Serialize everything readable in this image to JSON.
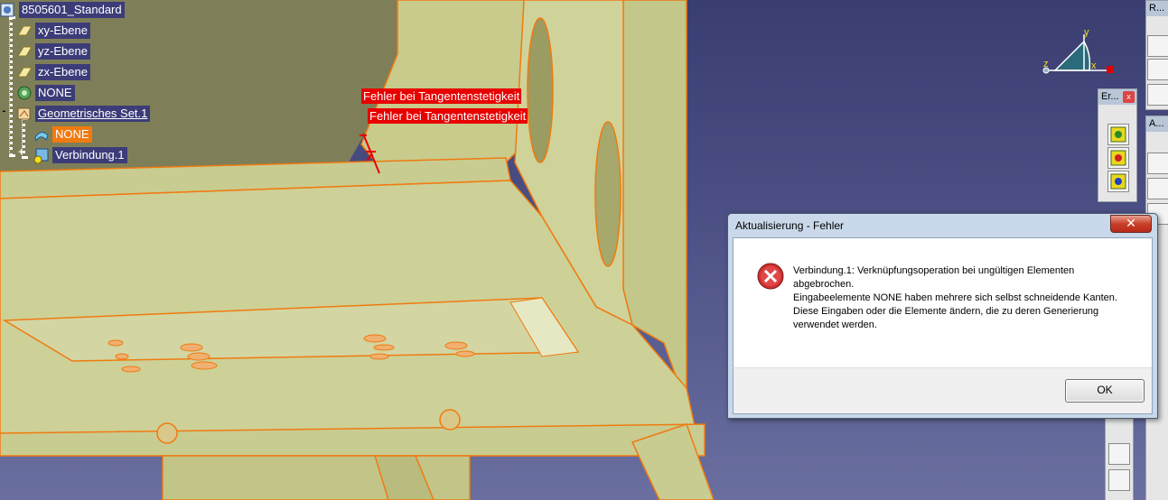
{
  "tree": {
    "root_label": "8505601_Standard",
    "items": [
      {
        "label": "xy-Ebene",
        "icon": "plane-icon"
      },
      {
        "label": "yz-Ebene",
        "icon": "plane-icon"
      },
      {
        "label": "zx-Ebene",
        "icon": "plane-icon"
      },
      {
        "label": "NONE",
        "icon": "gear-icon"
      },
      {
        "label": "Geometrisches Set.1",
        "icon": "geometric-set-icon"
      },
      {
        "label": "NONE",
        "icon": "surface-icon"
      },
      {
        "label": "Verbindung.1",
        "icon": "join-icon"
      }
    ],
    "expander_minus": "-",
    "expander_plus": "+"
  },
  "annotations": [
    "Fehler bei Tangentenstetigkeit",
    "Fehler bei Tangentenstetigkeit"
  ],
  "compass": {
    "x": "x",
    "y": "y",
    "z": "z"
  },
  "toolbars": {
    "top_right_title": "R...",
    "er_title": "Er...",
    "er_close": "x",
    "a_title": "A..."
  },
  "dialog": {
    "title": "Aktualisierung - Fehler",
    "close": "✕",
    "messages": [
      "Verbindung.1: Verknüpfungsoperation bei ungültigen Elementen abgebrochen.",
      "Eingabeelemente NONE haben mehrere sich selbst schneidende Kanten.",
      "Diese Eingaben oder die Elemente ändern, die zu deren Generierung verwendet werden."
    ],
    "ok_label": "OK"
  },
  "colors": {
    "background": "#3d3f72",
    "part_fill": "#cdd197",
    "part_edge": "#f07a10",
    "tree_label_bg": "#3c3c78",
    "tree_selected_bg": "#f07a10",
    "annotation_bg": "#e80000"
  }
}
